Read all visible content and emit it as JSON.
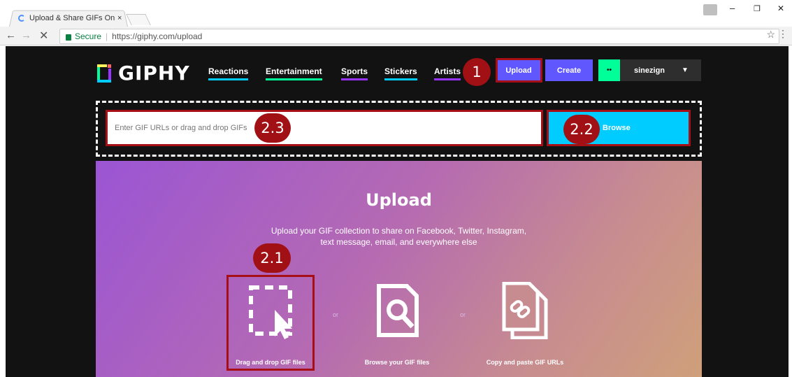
{
  "browser": {
    "tab_title": "Upload & Share GIFs Onl",
    "tab_close": "×",
    "secure_label": "Secure",
    "url": "https://giphy.com/upload",
    "window_controls": [
      "–",
      "❐",
      "✕"
    ]
  },
  "site": {
    "logo": "GIPHY",
    "nav": [
      {
        "label": "Reactions",
        "color": "#00ccff"
      },
      {
        "label": "Entertainment",
        "color": "#00ff99"
      },
      {
        "label": "Sports",
        "color": "#9933ff"
      },
      {
        "label": "Stickers",
        "color": "#00ccff"
      },
      {
        "label": "Artists",
        "color": "#9933ff"
      }
    ],
    "upload_button": "Upload",
    "create_button": "Create",
    "username": "sinezign",
    "avatar_glyph": "••"
  },
  "uploader": {
    "input_placeholder": "Enter GIF URLs or drag and drop GIFs",
    "browse_button": "Browse",
    "title": "Upload",
    "subtitle_line1": "Upload your GIF collection to share on Facebook, Twitter, Instagram,",
    "subtitle_line2": "text message, email, and everywhere else",
    "options": [
      {
        "label": "Drag and drop GIF files",
        "icon": "drag-drop-icon"
      },
      {
        "label": "Browse your GIF files",
        "icon": "browse-file-icon"
      },
      {
        "label": "Copy and paste GIF URLs",
        "icon": "link-file-icon"
      }
    ],
    "or_label": "or"
  },
  "annotations": {
    "m1": "1",
    "m21": "2.1",
    "m22": "2.2",
    "m23": "2.3"
  },
  "colors": {
    "accent_purple": "#6157ff",
    "browse_cyan": "#00ccff",
    "annotation_red": "#a50f15"
  }
}
